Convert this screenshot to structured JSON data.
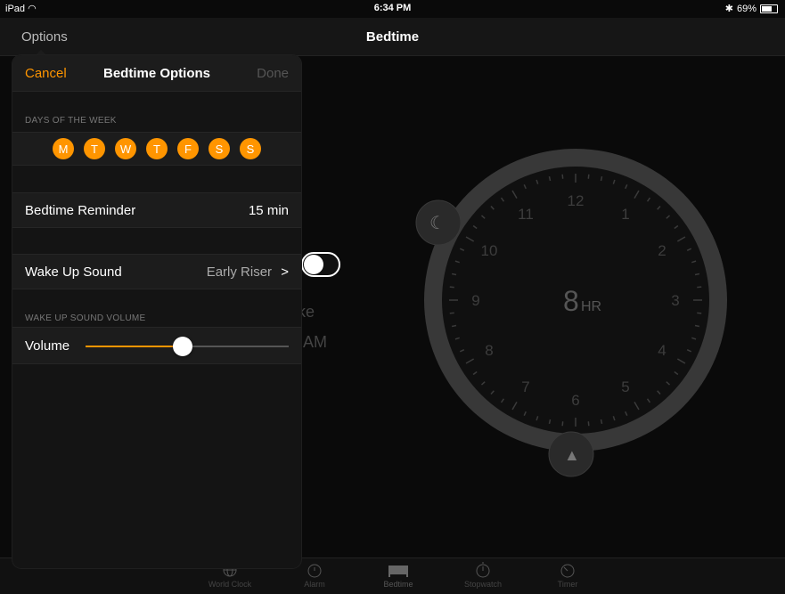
{
  "status_bar": {
    "device": "iPad",
    "time": "6:34 PM",
    "battery": "69%",
    "battery_level": 0.69
  },
  "nav": {
    "options_label": "Options",
    "title": "Bedtime"
  },
  "background": {
    "partial_label": "ke",
    "partial_time": ")AM",
    "clock": {
      "numbers": [
        "12",
        "1",
        "2",
        "3",
        "4",
        "5",
        "6",
        "7",
        "8",
        "9",
        "10",
        "11"
      ],
      "duration_value": "8",
      "duration_unit": "HR"
    }
  },
  "popover": {
    "cancel_label": "Cancel",
    "title": "Bedtime Options",
    "done_label": "Done",
    "days_section_label": "DAYS OF THE WEEK",
    "days": [
      "M",
      "T",
      "W",
      "T",
      "F",
      "S",
      "S"
    ],
    "reminder_label": "Bedtime Reminder",
    "reminder_value": "15 min",
    "wake_sound_label": "Wake Up Sound",
    "wake_sound_value": "Early Riser",
    "chevron": ">",
    "volume_section_label": "WAKE UP SOUND VOLUME",
    "volume_label": "Volume",
    "volume_level": 0.48
  },
  "tabs": [
    {
      "label": "World Clock",
      "icon": "globe-icon"
    },
    {
      "label": "Alarm",
      "icon": "alarm-icon"
    },
    {
      "label": "Bedtime",
      "icon": "bed-icon"
    },
    {
      "label": "Stopwatch",
      "icon": "stopwatch-icon"
    },
    {
      "label": "Timer",
      "icon": "timer-icon"
    }
  ],
  "colors": {
    "accent": "#ff9500",
    "background": "#0a0a0a",
    "panel": "#1c1c1c"
  }
}
